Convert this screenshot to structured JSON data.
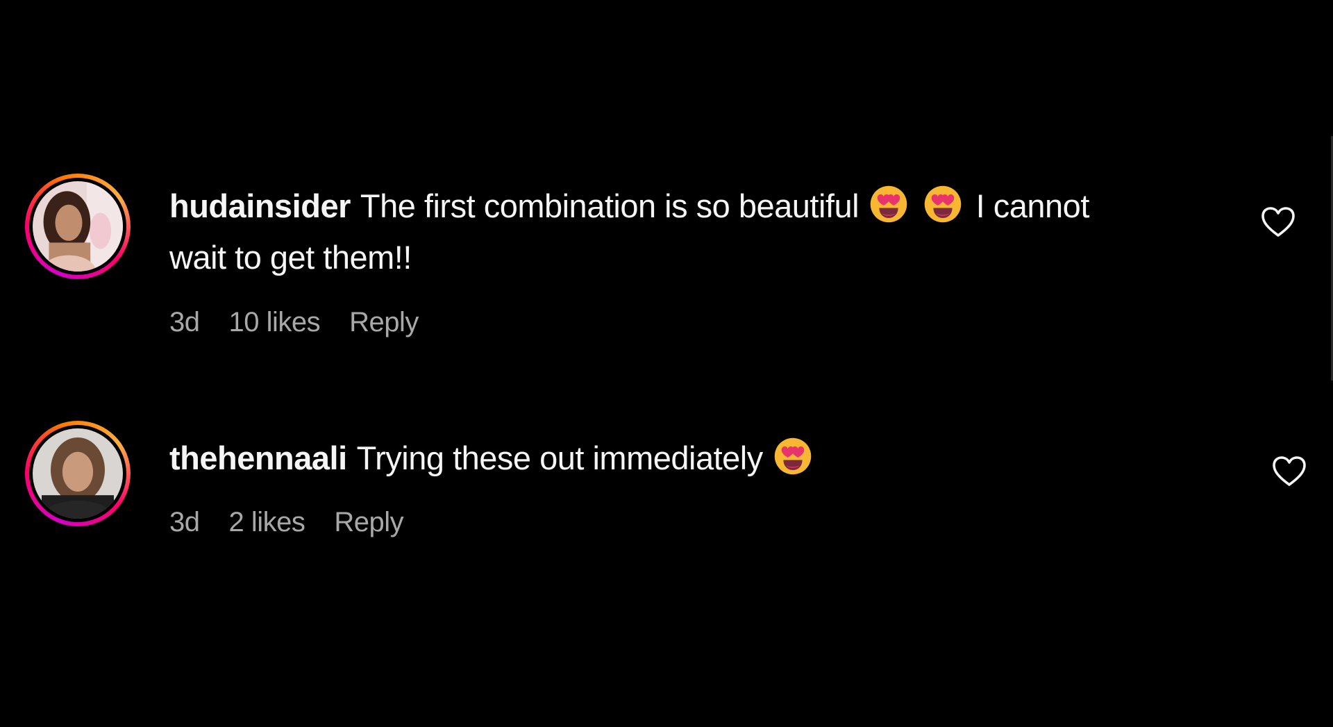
{
  "comments": [
    {
      "username": "hudainsider",
      "text_before": "The first combination is so beautiful",
      "text_after": "I cannot wait to get them!!",
      "emojis": [
        "smiling-face-with-heart-eyes",
        "smiling-face-with-heart-eyes"
      ],
      "time": "3d",
      "likes": "10 likes",
      "reply": "Reply"
    },
    {
      "username": "thehennaali",
      "text_before": "Trying these out immediately",
      "text_after": "",
      "emojis": [
        "smiling-face-with-heart-eyes"
      ],
      "time": "3d",
      "likes": "2 likes",
      "reply": "Reply"
    }
  ],
  "icons": {
    "like": "heart-outline-icon",
    "emoji": "smiling-face-with-heart-eyes"
  },
  "colors": {
    "background": "#000000",
    "text": "#f5f5f5",
    "meta": "#a8a8a8",
    "story_ring_start": "#f9a825",
    "story_ring_end": "#d300c5",
    "emoji_face": "#f7b733",
    "emoji_heart": "#e8336c"
  }
}
